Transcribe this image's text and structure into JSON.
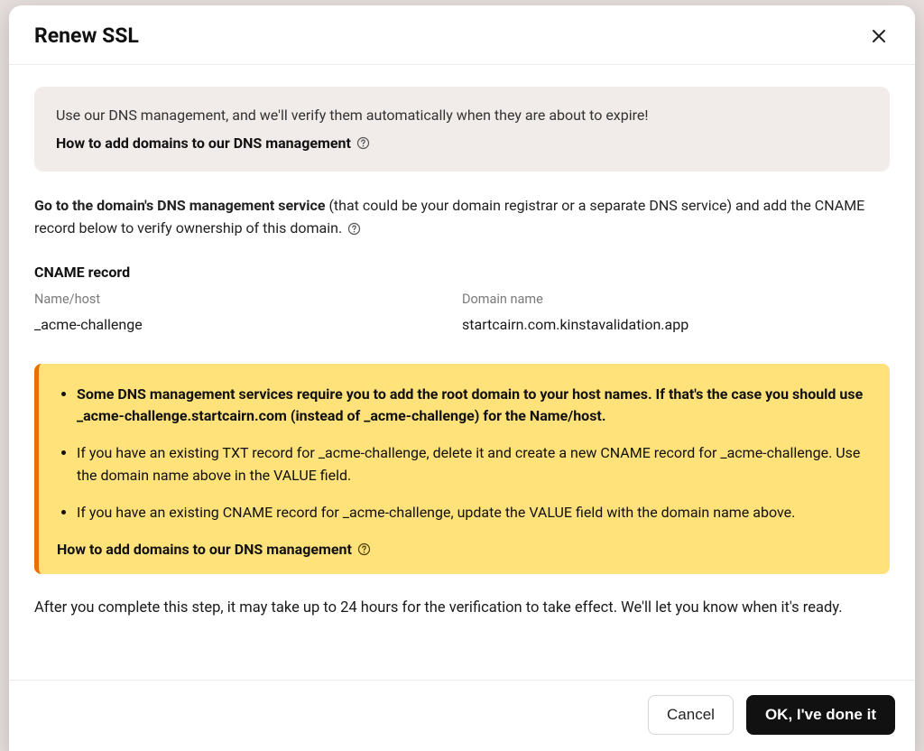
{
  "modal": {
    "title": "Renew SSL"
  },
  "banner": {
    "text": "Use our DNS management, and we'll verify them automatically when they are about to expire!",
    "link": "How to add domains to our DNS management"
  },
  "instruction": {
    "bold": "Go to the domain's DNS management service",
    "rest": " (that could be your domain registrar or a separate DNS service) and add the CNAME record below to verify ownership of this domain."
  },
  "record": {
    "section_label": "CNAME record",
    "name_head": "Name/host",
    "name_val": "_acme-challenge",
    "domain_head": "Domain name",
    "domain_val": "startcairn.com.kinstavalidation.app"
  },
  "warn": {
    "item1_a": "Some DNS management services require you to add the root domain to your host names. If that's the case you should use ",
    "item1_b": "_acme-challenge.startcairn.com",
    "item1_c": " (instead of _acme-challenge) for the Name/host.",
    "item2": "If you have an existing TXT record for _acme-challenge, delete it and create a new CNAME record for _acme-challenge. Use the domain name above in the VALUE field.",
    "item3": "If you have an existing CNAME record for _acme-challenge, update the VALUE field with the domain name above.",
    "link": "How to add domains to our DNS management"
  },
  "after": "After you complete this step, it may take up to 24 hours for the verification to take effect. We'll let you know when it's ready.",
  "footer": {
    "cancel": "Cancel",
    "ok": "OK, I've done it"
  }
}
